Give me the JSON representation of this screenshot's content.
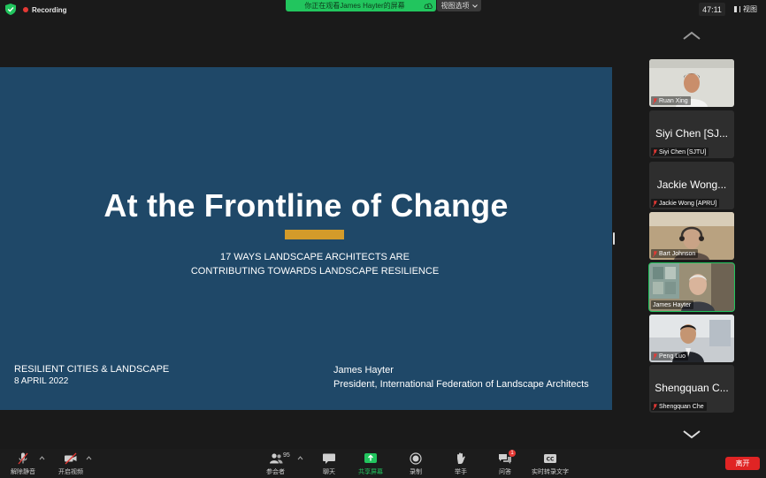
{
  "topbar": {
    "recording_label": "Recording",
    "viewing_text": "你正在观看James Hayter的屏幕",
    "view_options_label": "视图选项",
    "timer": "47:11",
    "view_label": "视图"
  },
  "slide": {
    "title": "At the Frontline of Change",
    "subtitle_line1": "17 WAYS LANDSCAPE ARCHITECTS ARE",
    "subtitle_line2": "CONTRIBUTING TOWARDS LANDSCAPE RESILIENCE",
    "event": "RESILIENT CITIES & LANDSCAPE",
    "date": "8 APRIL 2022",
    "presenter": "James Hayter",
    "presenter_title": "President, International Federation of Landscape Architects",
    "accent_color": "#d39b2a",
    "background_color": "#1f4868"
  },
  "participants": [
    {
      "label": "Ruan Xing",
      "big_name": "",
      "video": true,
      "muted": true,
      "active": false
    },
    {
      "label": "Siyi Chen [SJTU]",
      "big_name": "Siyi Chen [SJ...",
      "video": false,
      "muted": true,
      "active": false
    },
    {
      "label": "Jackie Wong [APRU]",
      "big_name": "Jackie Wong...",
      "video": false,
      "muted": true,
      "active": false
    },
    {
      "label": "Bart Johnson",
      "big_name": "",
      "video": true,
      "muted": true,
      "active": false
    },
    {
      "label": "James Hayter",
      "big_name": "",
      "video": true,
      "muted": false,
      "active": true
    },
    {
      "label": "Peng Luo",
      "big_name": "",
      "video": true,
      "muted": true,
      "active": false
    },
    {
      "label": "Shengquan Che",
      "big_name": "Shengquan C...",
      "video": false,
      "muted": true,
      "active": false
    }
  ],
  "toolbar": {
    "unmute_label": "解除静音",
    "start_video_label": "开启视频",
    "participants_label": "参会者",
    "participants_count": "95",
    "chat_label": "聊天",
    "share_label": "共享屏幕",
    "record_label": "录制",
    "raise_hand_label": "举手",
    "qa_label": "问答",
    "qa_badge": "1",
    "captions_label": "实时转录文字",
    "cc_text": "CC",
    "leave_label": "离开"
  }
}
